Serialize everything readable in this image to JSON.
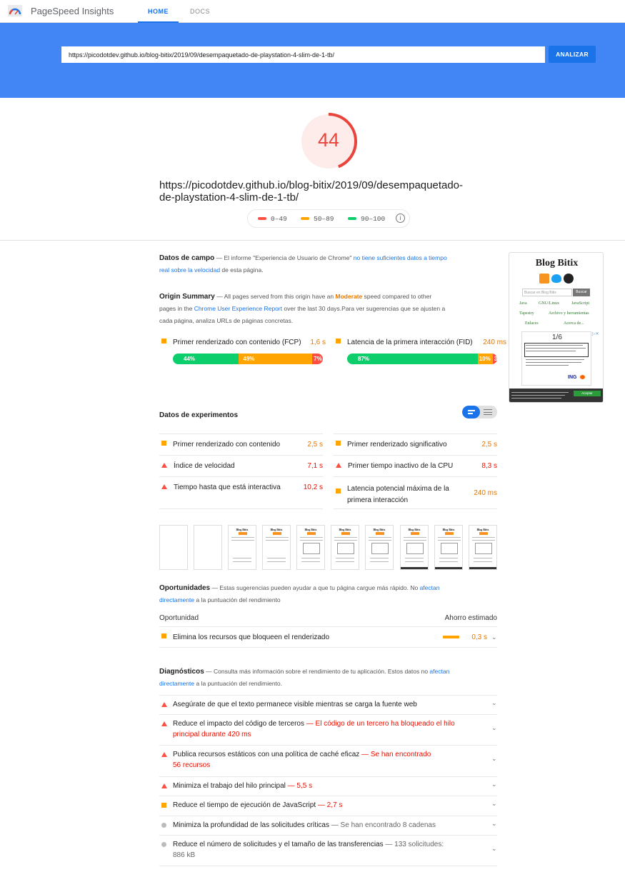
{
  "app": {
    "title": "PageSpeed Insights"
  },
  "nav": {
    "tabs": [
      "HOME",
      "DOCS"
    ],
    "active": "HOME"
  },
  "search": {
    "url": "https://picodotdev.github.io/blog-bitix/2019/09/desempaquetado-de-playstation-4-slim-de-1-tb/",
    "button": "ANALIZAR"
  },
  "score": {
    "value": "44",
    "fraction": 0.44,
    "color": "#e8453c"
  },
  "report": {
    "url_line1": "https://picodotdev.github.io/blog-bitix/2019/09/desempaquetado-",
    "url_line2": "de-playstation-4-slim-de-1-tb/"
  },
  "legend": [
    {
      "label": "0–49",
      "color": "#ff4e42"
    },
    {
      "label": "50–89",
      "color": "#ffa400"
    },
    {
      "label": "90–100",
      "color": "#0cce6b"
    }
  ],
  "field": {
    "title": "Datos de campo",
    "desc_pre": "— El informe \"Experiencia de Usuario de Chrome\" ",
    "desc_link1": "no tiene suficientes datos a tiempo",
    "desc_link2": "real sobre la velocidad",
    "desc_post": " de esta página."
  },
  "origin": {
    "title": "Origin Summary",
    "l1_pre": "— All pages served from this origin have an ",
    "l1_mod": "Moderate",
    "l1_post": " speed compared to other",
    "l2_pre": "pages in the ",
    "l2_link": "Chrome User Experience Report",
    "l2_post": " over the last 30 days.Para ver sugerencias que se ajusten a",
    "l3": "cada página, analiza URLs de páginas concretas.",
    "fcp": {
      "label": "Primer renderizado con contenido (FCP)",
      "value": "1,6 s",
      "fast": 44,
      "avg": 49,
      "slow": 7,
      "fast_label": "44%",
      "avg_label": "49%",
      "slow_label": "7%"
    },
    "fid": {
      "label": "Latencia de la primera interacción (FID)",
      "value": "240 ms",
      "fast": 87,
      "avg": 10,
      "slow": 3,
      "fast_label": "87%",
      "avg_label": "10%",
      "slow_label": "3%"
    }
  },
  "lab": {
    "title": "Datos de experimentos",
    "left": [
      {
        "label": "Primer renderizado con contenido",
        "value": "2,5 s",
        "status": "avg"
      },
      {
        "label": "Índice de velocidad",
        "value": "7,1 s",
        "status": "slow"
      },
      {
        "label": "Tiempo hasta que está interactiva",
        "value": "10,2 s",
        "status": "slow"
      }
    ],
    "right": [
      {
        "label": "Primer renderizado significativo",
        "value": "2,5 s",
        "status": "avg"
      },
      {
        "label": "Primer tiempo inactivo de la CPU",
        "value": "8,3 s",
        "status": "slow"
      },
      {
        "label": "Latencia potencial máxima de la",
        "label2": "primera interacción",
        "value": "240 ms",
        "status": "avg"
      }
    ]
  },
  "filmstrip": {
    "blog_title": "Blog Bitix"
  },
  "opportunities": {
    "title": "Oportunidades",
    "desc_pre": "— Estas sugerencias pueden ayudar a que tu página cargue más rápido. No ",
    "desc_link": "afectan",
    "desc_link2": "directamente",
    "desc_post": " a la puntuación del rendimiento",
    "col1": "Oportunidad",
    "col2": "Ahorro estimado",
    "items": [
      {
        "label": "Elimina los recursos que bloqueen el renderizado",
        "value": "0,3 s"
      }
    ]
  },
  "diagnostics": {
    "title": "Diagnósticos",
    "desc_pre": "— Consulta más información sobre el rendimiento de tu aplicación. Estos datos no ",
    "desc_link": "afectan",
    "desc_link2": "directamente",
    "desc_post": " a la puntuación del rendimiento.",
    "items": [
      {
        "label": "Asegúrate de que el texto permanece visible mientras se carga la fuente web",
        "msg": "",
        "msg2": "",
        "status": "slow"
      },
      {
        "label": "Reduce el impacto del código de terceros",
        "msg": "— El código de un tercero ha bloqueado el hilo",
        "msg2": "principal durante 420 ms",
        "status": "slow"
      },
      {
        "label": "Publica recursos estáticos con una política de caché eficaz",
        "msg": "— Se han encontrado",
        "msg2": "56 recursos",
        "status": "slow"
      },
      {
        "label": "Minimiza el trabajo del hilo principal",
        "msg": "— 5,5 s",
        "msg2": "",
        "status": "slow"
      },
      {
        "label": "Reduce el tiempo de ejecución de JavaScript",
        "msg": "— 2,7 s",
        "msg2": "",
        "status": "avg"
      },
      {
        "label": "Minimiza la profundidad de las solicitudes críticas",
        "msg": "— Se han encontrado 8 cadenas",
        "msg2": "",
        "status": "info"
      },
      {
        "label": "Reduce el número de solicitudes y el tamaño de las transferencias",
        "msg": "— 133 solicitudes:",
        "msg2": "886 kB",
        "status": "info"
      }
    ]
  },
  "preview": {
    "blog_title": "Blog Bitix",
    "search_placeholder": "Buscar en Blog Bitix",
    "search_button": "Buscar",
    "links_row1": [
      "Java",
      "GNU/Linux",
      "JavaScript"
    ],
    "links_row2": [
      "Tapestry",
      "Archivo y herramientas"
    ],
    "links_row3": [
      "Enlaces",
      "Acerca de..."
    ],
    "ad_counter": "1/6",
    "ad_brand": "ING",
    "cookie_button": "Aceptar"
  }
}
